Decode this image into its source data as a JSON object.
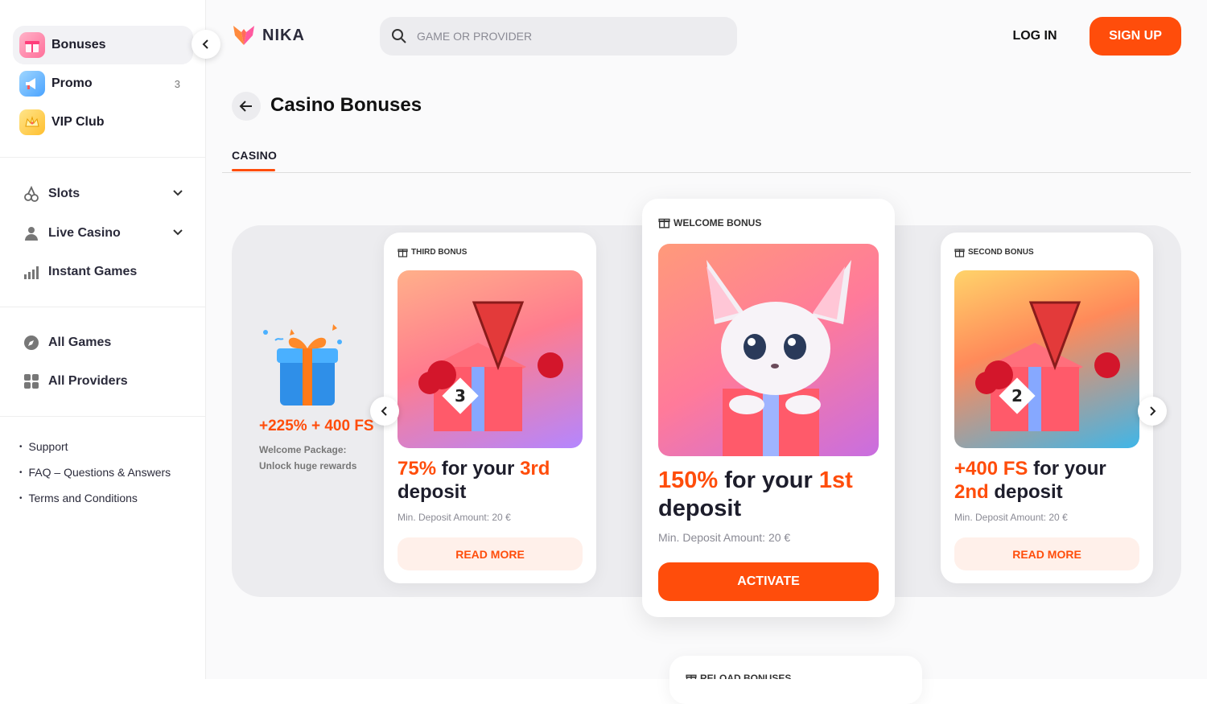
{
  "sidebar": {
    "top_items": [
      {
        "label": "Bonuses",
        "icon": "gift-icon",
        "badge": ""
      },
      {
        "label": "Promo",
        "icon": "megaphone-icon",
        "badge": "3"
      },
      {
        "label": "VIP Club",
        "icon": "crown-icon",
        "badge": ""
      }
    ],
    "nav_items": [
      {
        "label": "Slots",
        "icon": "cherry-icon"
      },
      {
        "label": "Live Casino",
        "icon": "dealer-icon"
      },
      {
        "label": "Instant Games",
        "icon": "bar-chart-icon"
      }
    ],
    "game_items": [
      {
        "label": "All Games",
        "icon": "compass-icon"
      },
      {
        "label": "All Providers",
        "icon": "grid-icon"
      }
    ],
    "footer_links": [
      "Support",
      "FAQ – Questions & Answers",
      "Terms and Conditions"
    ]
  },
  "header": {
    "logo_text": "NIKA",
    "search_placeholder": "GAME OR PROVIDER",
    "login_label": "LOG IN",
    "signup_label": "SIGN UP"
  },
  "page": {
    "title": "Casino Bonuses",
    "tab": "CASINO"
  },
  "promo": {
    "headline": "+225% + 400 FS",
    "line1": "Welcome Package:",
    "line2": "Unlock huge rewards"
  },
  "cards": {
    "third": {
      "tag": "THIRD BONUS",
      "hl1": "75%",
      "t1": " for your ",
      "hl2": "3rd",
      "t2": "deposit",
      "min": "Min. Deposit Amount: 20 €",
      "button": "READ MORE"
    },
    "welcome": {
      "tag": "WELCOME BONUS",
      "hl1": "150%",
      "t1": " for your ",
      "hl2": "1st",
      "t2": "deposit",
      "min": "Min. Deposit Amount: 20 €",
      "button": "ACTIVATE"
    },
    "second": {
      "tag": "SECOND BONUS",
      "hl1": "+400 FS",
      "t1": " for your",
      "hl2": "2nd",
      "t2": " deposit",
      "min": "Min. Deposit Amount: 20 €",
      "button": "READ MORE"
    },
    "reload": {
      "tag": "RELOAD BONUSES"
    }
  },
  "colors": {
    "accent": "#ff4d0b",
    "panel": "#ececef"
  }
}
